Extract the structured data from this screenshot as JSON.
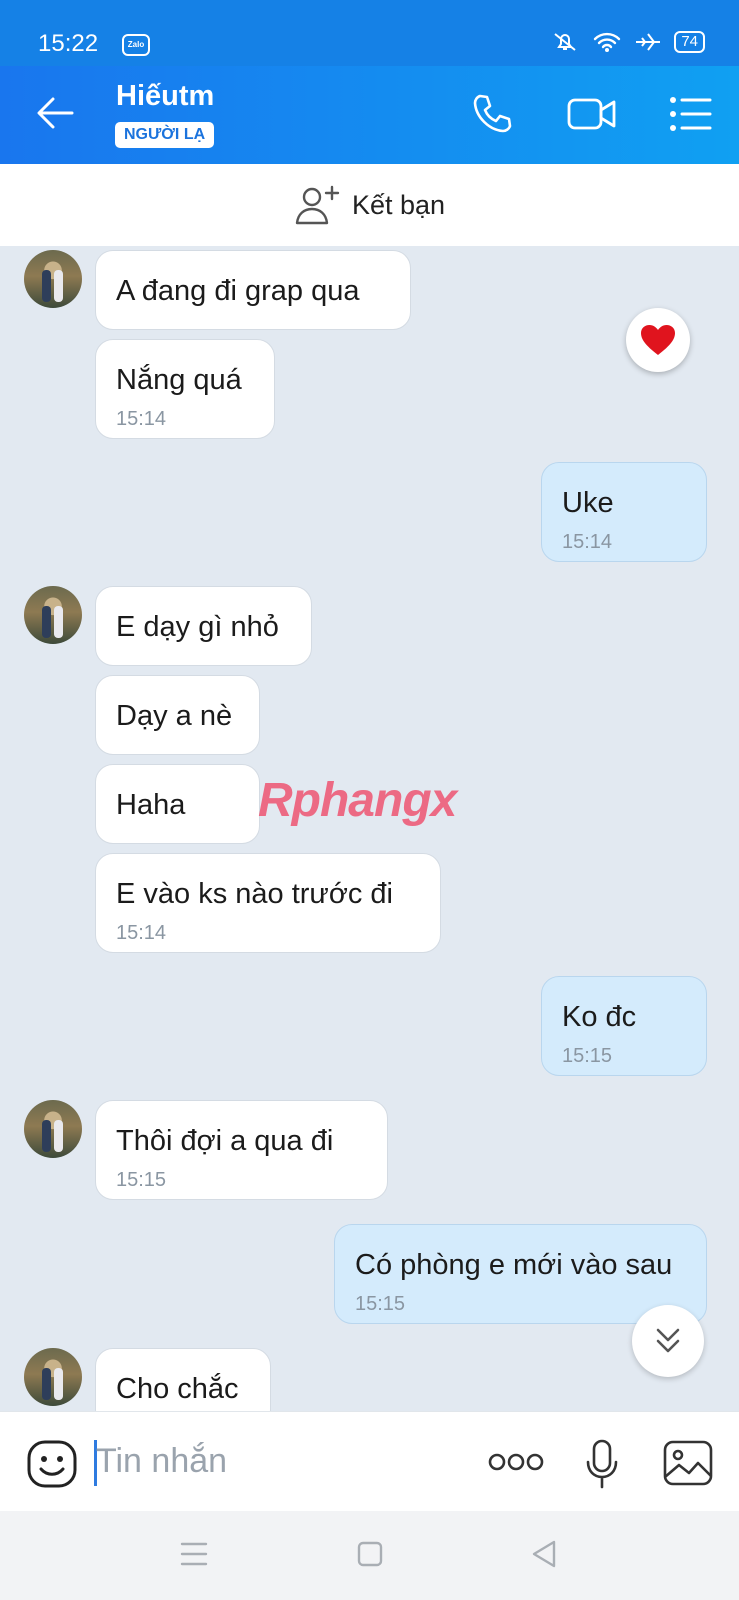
{
  "status_bar": {
    "time": "15:22",
    "app_badge": "Zalo",
    "battery": "74"
  },
  "header": {
    "contact_name": "Hiếutm",
    "stranger_badge": "NGƯỜI LẠ"
  },
  "friend_bar": {
    "label": "Kết bạn"
  },
  "messages": [
    {
      "side": "in",
      "text": "A đang đi grap qua",
      "time": ""
    },
    {
      "side": "in",
      "text": "Nắng quá",
      "time": "15:14"
    },
    {
      "side": "out",
      "text": "Uke",
      "time": "15:14"
    },
    {
      "side": "in",
      "text": "E dạy gì nhỏ",
      "time": ""
    },
    {
      "side": "in",
      "text": "Dạy a nè",
      "time": ""
    },
    {
      "side": "in",
      "text": "Haha",
      "time": ""
    },
    {
      "side": "in",
      "text": "E vào ks nào trước đi",
      "time": "15:14"
    },
    {
      "side": "out",
      "text": "Ko đc",
      "time": "15:15"
    },
    {
      "side": "in",
      "text": "Thôi đợi a qua đi",
      "time": "15:15"
    },
    {
      "side": "out",
      "text": "Có phòng e mới vào sau",
      "time": "15:15"
    },
    {
      "side": "in",
      "text": "Cho chắc",
      "time": ""
    }
  ],
  "watermark": "Rphangx",
  "input": {
    "placeholder": "Tin nhắn"
  },
  "colors": {
    "header_blue": "#1581e6",
    "incoming_bubble": "#ffffff",
    "outgoing_bubble": "#d4ebfc",
    "chat_background": "#e2e9f1"
  },
  "icons": [
    "back-arrow-icon",
    "phone-icon",
    "video-call-icon",
    "menu-list-icon",
    "add-friend-icon",
    "heart-reaction-icon",
    "scroll-down-icon",
    "emoji-icon",
    "more-icon",
    "mic-icon",
    "image-icon"
  ]
}
